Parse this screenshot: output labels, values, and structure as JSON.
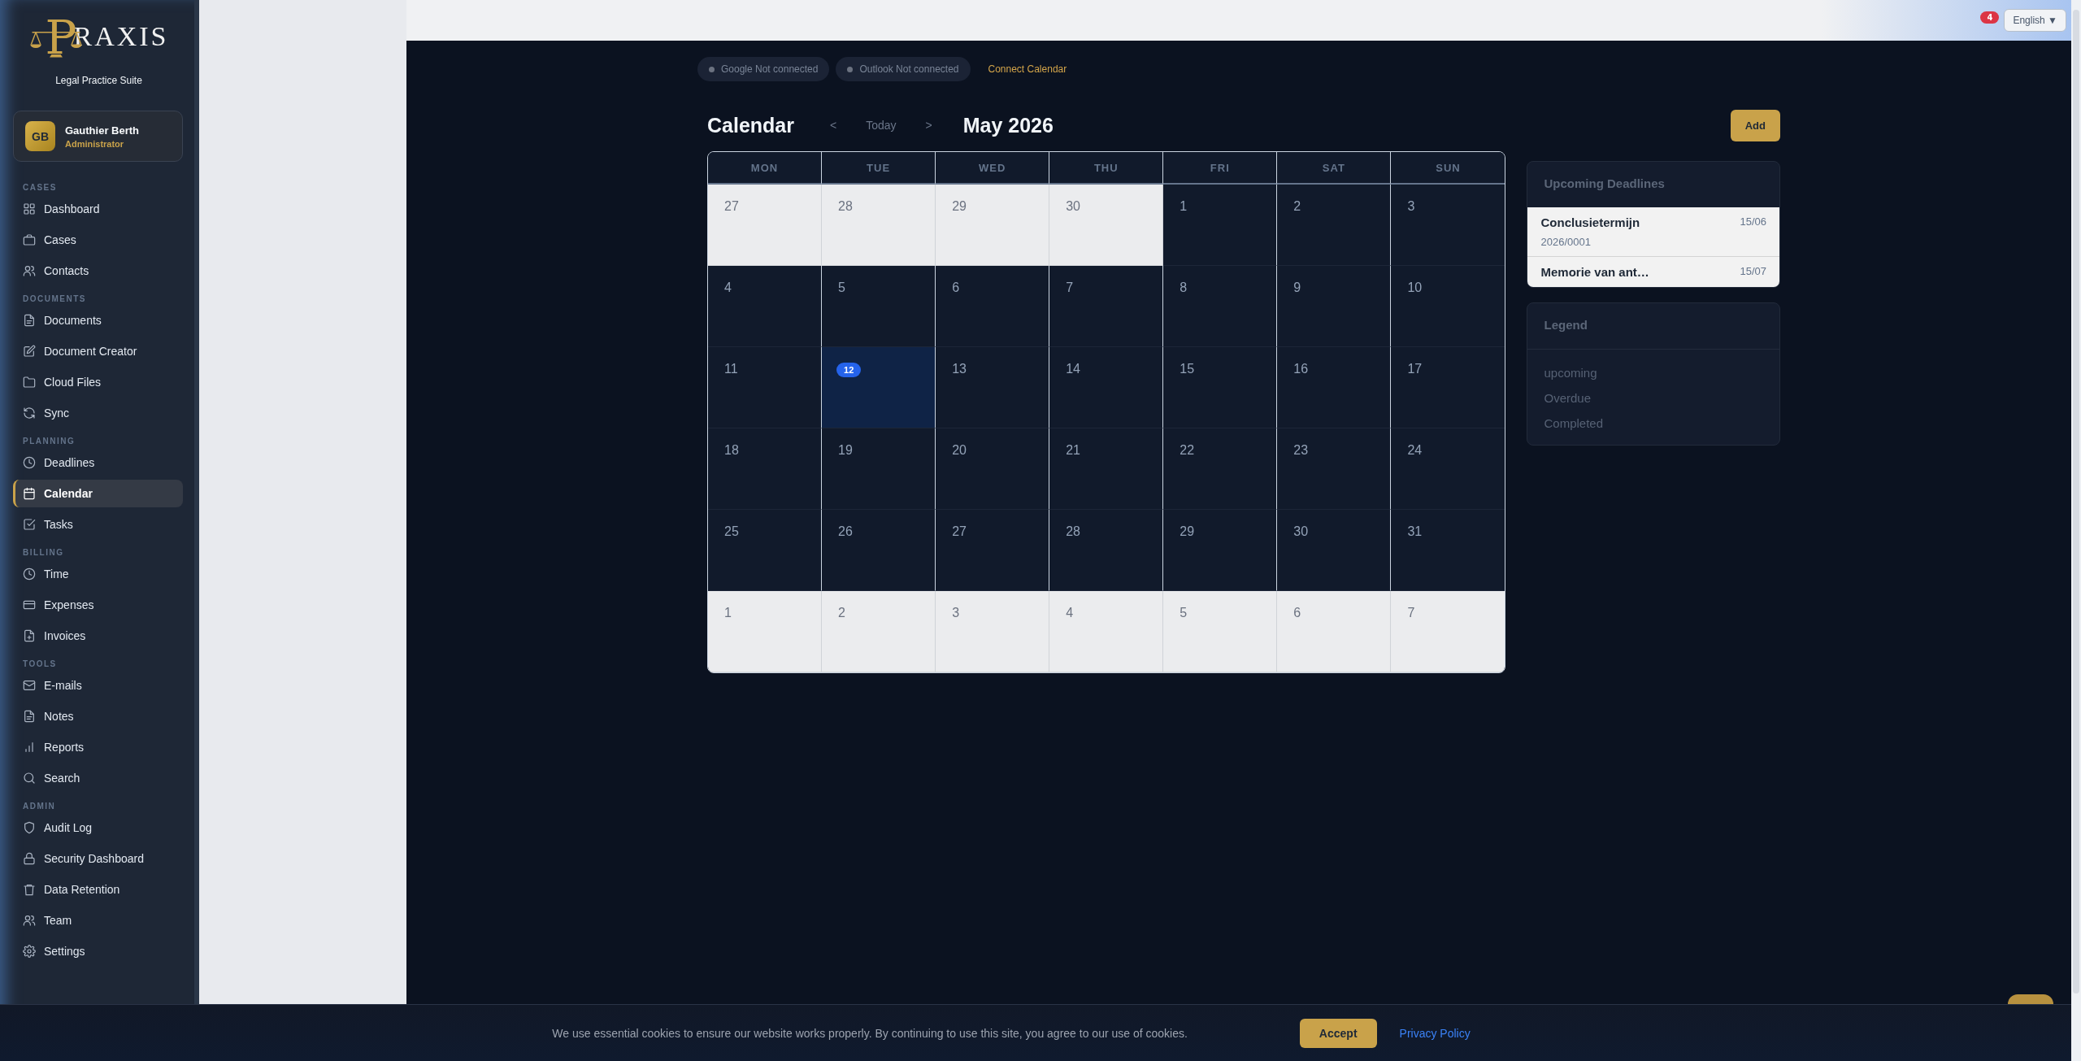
{
  "sidebar": {
    "logo": {
      "initial": "P",
      "rest": "RAXIS"
    },
    "tagline": "Legal Practice Suite",
    "user": {
      "initials": "GB",
      "name": "Gauthier Berth",
      "role": "Administrator"
    },
    "sections": [
      {
        "label": "CASES",
        "items": [
          {
            "label": "Dashboard",
            "selected": false
          },
          {
            "label": "Cases",
            "selected": false
          },
          {
            "label": "Contacts",
            "selected": false
          }
        ]
      },
      {
        "label": "DOCUMENTS",
        "items": [
          {
            "label": "Documents",
            "selected": false
          },
          {
            "label": "Document Creator",
            "selected": false
          },
          {
            "label": "Cloud Files",
            "selected": false
          },
          {
            "label": "Sync",
            "selected": false
          }
        ]
      },
      {
        "label": "PLANNING",
        "items": [
          {
            "label": "Deadlines",
            "selected": false
          },
          {
            "label": "Calendar",
            "selected": true
          },
          {
            "label": "Tasks",
            "selected": false
          }
        ]
      },
      {
        "label": "BILLING",
        "items": [
          {
            "label": "Time",
            "selected": false
          },
          {
            "label": "Expenses",
            "selected": false
          },
          {
            "label": "Invoices",
            "selected": false
          }
        ]
      },
      {
        "label": "TOOLS",
        "items": [
          {
            "label": "E-mails",
            "selected": false
          },
          {
            "label": "Notes",
            "selected": false
          },
          {
            "label": "Reports",
            "selected": false
          },
          {
            "label": "Search",
            "selected": false
          }
        ]
      },
      {
        "label": "ADMIN",
        "items": [
          {
            "label": "Audit Log",
            "selected": false
          },
          {
            "label": "Security Dashboard",
            "selected": false
          },
          {
            "label": "Data Retention",
            "selected": false
          },
          {
            "label": "Team",
            "selected": false
          },
          {
            "label": "Settings",
            "selected": false
          }
        ]
      }
    ]
  },
  "top_bar": {
    "notification_count": "4",
    "language": "English ▼"
  },
  "integrations": [
    {
      "label": "Google Not connected",
      "connected": false
    },
    {
      "label": "Outlook Not connected",
      "connected": false
    }
  ],
  "connect_link": "Connect Calendar",
  "header": {
    "title": "Calendar",
    "prev": "<",
    "today": "Today",
    "next": ">",
    "month": "May 2026",
    "add_button": "Add"
  },
  "calendar": {
    "weekdays": [
      "MON",
      "TUE",
      "WED",
      "THU",
      "FRI",
      "SAT",
      "SUN"
    ],
    "weeks": [
      [
        {
          "day": "27",
          "other_month": true,
          "today": false
        },
        {
          "day": "28",
          "other_month": true,
          "today": false
        },
        {
          "day": "29",
          "other_month": true,
          "today": false
        },
        {
          "day": "30",
          "other_month": true,
          "today": false
        },
        {
          "day": "1",
          "other_month": false,
          "today": false
        },
        {
          "day": "2",
          "other_month": false,
          "today": false
        },
        {
          "day": "3",
          "other_month": false,
          "today": false
        }
      ],
      [
        {
          "day": "4",
          "other_month": false,
          "today": false
        },
        {
          "day": "5",
          "other_month": false,
          "today": false
        },
        {
          "day": "6",
          "other_month": false,
          "today": false
        },
        {
          "day": "7",
          "other_month": false,
          "today": false
        },
        {
          "day": "8",
          "other_month": false,
          "today": false
        },
        {
          "day": "9",
          "other_month": false,
          "today": false
        },
        {
          "day": "10",
          "other_month": false,
          "today": false
        }
      ],
      [
        {
          "day": "11",
          "other_month": false,
          "today": false
        },
        {
          "day": "12",
          "other_month": false,
          "today": true
        },
        {
          "day": "13",
          "other_month": false,
          "today": false
        },
        {
          "day": "14",
          "other_month": false,
          "today": false
        },
        {
          "day": "15",
          "other_month": false,
          "today": false
        },
        {
          "day": "16",
          "other_month": false,
          "today": false
        },
        {
          "day": "17",
          "other_month": false,
          "today": false
        }
      ],
      [
        {
          "day": "18",
          "other_month": false,
          "today": false
        },
        {
          "day": "19",
          "other_month": false,
          "today": false
        },
        {
          "day": "20",
          "other_month": false,
          "today": false
        },
        {
          "day": "21",
          "other_month": false,
          "today": false
        },
        {
          "day": "22",
          "other_month": false,
          "today": false
        },
        {
          "day": "23",
          "other_month": false,
          "today": false
        },
        {
          "day": "24",
          "other_month": false,
          "today": false
        }
      ],
      [
        {
          "day": "25",
          "other_month": false,
          "today": false
        },
        {
          "day": "26",
          "other_month": false,
          "today": false
        },
        {
          "day": "27",
          "other_month": false,
          "today": false
        },
        {
          "day": "28",
          "other_month": false,
          "today": false
        },
        {
          "day": "29",
          "other_month": false,
          "today": false
        },
        {
          "day": "30",
          "other_month": false,
          "today": false
        },
        {
          "day": "31",
          "other_month": false,
          "today": false
        }
      ],
      [
        {
          "day": "1",
          "other_month": true,
          "today": false
        },
        {
          "day": "2",
          "other_month": true,
          "today": false
        },
        {
          "day": "3",
          "other_month": true,
          "today": false
        },
        {
          "day": "4",
          "other_month": true,
          "today": false
        },
        {
          "day": "5",
          "other_month": true,
          "today": false
        },
        {
          "day": "6",
          "other_month": true,
          "today": false
        },
        {
          "day": "7",
          "other_month": true,
          "today": false
        }
      ]
    ]
  },
  "deadlines": {
    "title": "Upcoming Deadlines",
    "items": [
      {
        "title": "Conclusietermijn",
        "date": "15/06",
        "case": "2026/0001"
      },
      {
        "title": "Memorie van ant…",
        "date": "15/07"
      }
    ]
  },
  "legend": {
    "title": "Legend",
    "items": [
      "upcoming",
      "Overdue",
      "Completed"
    ]
  },
  "cookie_bar": {
    "text": "We use essential cookies to ensure our website works properly. By continuing to use this site, you agree to our use of cookies.",
    "accept": "Accept",
    "privacy": "Privacy Policy"
  }
}
